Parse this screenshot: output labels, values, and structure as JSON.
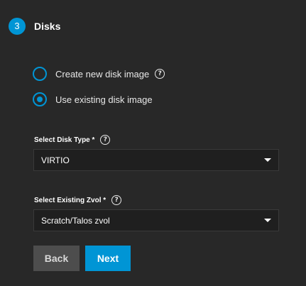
{
  "step": {
    "number": "3",
    "title": "Disks"
  },
  "options": {
    "create_label": "Create new disk image",
    "existing_label": "Use existing disk image",
    "selected": "existing"
  },
  "disk_type": {
    "label": "Select Disk Type *",
    "value": "VIRTIO"
  },
  "zvol": {
    "label": "Select Existing Zvol *",
    "value": "Scratch/Talos zvol"
  },
  "buttons": {
    "back_label": "Back",
    "next_label": "Next"
  },
  "icons": {
    "help": "?"
  },
  "colors": {
    "accent": "#0095d5",
    "background": "#282828",
    "field_background": "#1f1f1f",
    "back_button": "#4d4d4d"
  }
}
